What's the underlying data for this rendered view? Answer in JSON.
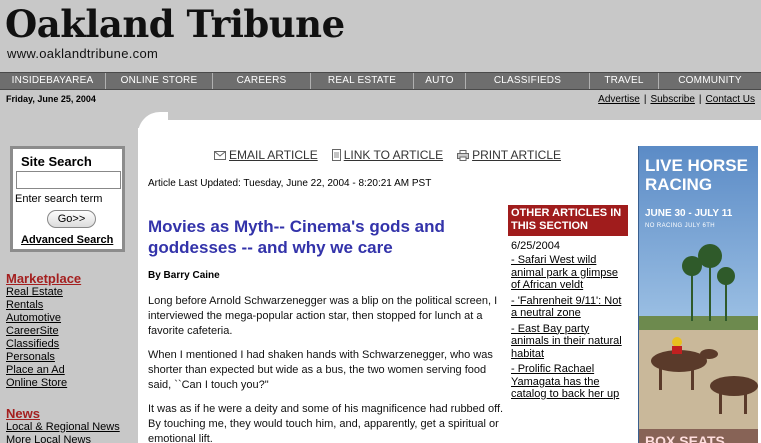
{
  "header": {
    "logo": "Oakland Tribune",
    "url": "www.oaklandtribune.com",
    "date": "Friday, June 25, 2004"
  },
  "nav": [
    "INSIDEBAYAREA",
    "ONLINE STORE",
    "CAREERS",
    "REAL ESTATE",
    "AUTO",
    "CLASSIFIEDS",
    "TRAVEL",
    "COMMUNITY"
  ],
  "toplinks": [
    "Advertise",
    "Subscribe",
    "Contact Us"
  ],
  "search": {
    "title": "Site Search",
    "label": "Enter search term",
    "go": "Go>>",
    "advanced": "Advanced Search"
  },
  "sidebar": {
    "marketplace": {
      "head": "Marketplace",
      "links": [
        "Real Estate",
        "Rentals",
        "Automotive",
        "CareerSite",
        "Classifieds",
        "Personals",
        "Place an Ad",
        "Online Store"
      ]
    },
    "news": {
      "head": "News",
      "links": [
        "Local & Regional News",
        "More Local News"
      ]
    }
  },
  "tools": {
    "email": "EMAIL ARTICLE",
    "link": "LINK TO ARTICLE",
    "print": "PRINT ARTICLE"
  },
  "article": {
    "updated": "Article Last Updated: Tuesday, June 22, 2004 - 8:20:21 AM PST",
    "headline": "Movies as Myth-- Cinema's gods and goddesses -- and why we care",
    "byline": "By Barry Caine",
    "paragraphs": [
      "Long before Arnold Schwarzenegger was a blip on the political screen, I interviewed the mega-popular action star, then stopped for lunch at a favorite cafeteria.",
      "When I mentioned I had shaken hands with Schwarzenegger, who was shorter than expected but wide as a bus, the two women serving food said, ``Can I touch you?\"",
      "It was as if he were a deity and some of his magnificence had rubbed off. By touching me, they would touch him, and, apparently, get a spiritual or emotional lift."
    ]
  },
  "other": {
    "head": "OTHER ARTICLES IN THIS SECTION",
    "date": "6/25/2004",
    "links": [
      "- Safari West wild animal park a glimpse of African veldt",
      "- 'Fahrenheit 9/11': Not a neutral zone",
      "- East Bay party animals in their natural habitat",
      "- Prolific Rachael Yamagata has the catalog to back her up"
    ]
  },
  "ad": {
    "title": "LIVE HORSE RACING",
    "dates": "JUNE 30 - JULY 11",
    "sub": "NO RACING JULY 6TH",
    "bottom": "BOX SEATS"
  }
}
